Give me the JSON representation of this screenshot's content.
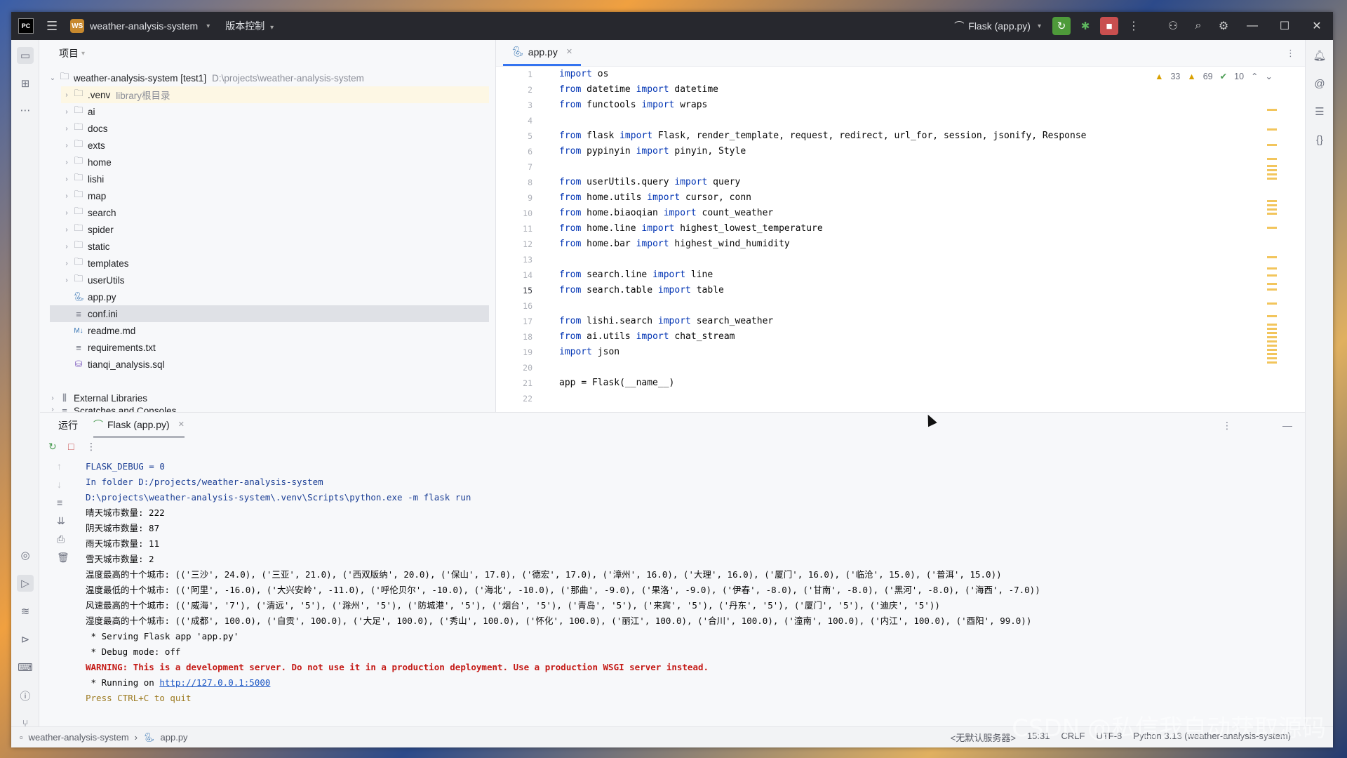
{
  "titlebar": {
    "logo": "PC",
    "project_badge": "WS",
    "project_name": "weather-analysis-system",
    "vcs_label": "版本控制",
    "run_config": "Flask (app.py)"
  },
  "project_pane": {
    "title": "项目",
    "root_label": "weather-analysis-system [test1]",
    "root_path": "D:\\projects\\weather-analysis-system",
    "items": [
      {
        "label": ".venv",
        "note": "library根目录"
      },
      {
        "label": "ai",
        "note": ""
      },
      {
        "label": "docs",
        "note": ""
      },
      {
        "label": "exts",
        "note": ""
      },
      {
        "label": "home",
        "note": ""
      },
      {
        "label": "lishi",
        "note": ""
      },
      {
        "label": "map",
        "note": ""
      },
      {
        "label": "search",
        "note": ""
      },
      {
        "label": "spider",
        "note": ""
      },
      {
        "label": "static",
        "note": ""
      },
      {
        "label": "templates",
        "note": ""
      },
      {
        "label": "userUtils",
        "note": ""
      },
      {
        "label": "app.py",
        "note": ""
      },
      {
        "label": "conf.ini",
        "note": ""
      },
      {
        "label": "readme.md",
        "note": ""
      },
      {
        "label": "requirements.txt",
        "note": ""
      },
      {
        "label": "tianqi_analysis.sql",
        "note": ""
      }
    ],
    "external_libraries": "External Libraries",
    "scratches": "Scratches and Consoles"
  },
  "editor": {
    "tab_label": "app.py",
    "inspections": {
      "warnings": "33",
      "weak_warnings": "69",
      "ok": "10"
    },
    "lines": [
      "import os",
      "from datetime import datetime",
      "from functools import wraps",
      "",
      "from flask import Flask, render_template, request, redirect, url_for, session, jsonify, Response",
      "from pypinyin import pinyin, Style",
      "",
      "from userUtils.query import query",
      "from home.utils import cursor, conn",
      "from home.biaoqian import count_weather",
      "from home.line import highest_lowest_temperature",
      "from home.bar import highest_wind_humidity",
      "",
      "from search.line import line",
      "from search.table import table",
      "",
      "from lishi.search import search_weather",
      "from ai.utils import chat_stream",
      "import json",
      "",
      "app = Flask(__name__)",
      ""
    ]
  },
  "run_panel": {
    "title": "运行",
    "tab_label": "Flask (app.py)",
    "console": [
      {
        "text": "FLASK_DEBUG = 0",
        "style": "c-blue"
      },
      {
        "text": "In folder D:/projects/weather-analysis-system",
        "style": "c-blue"
      },
      {
        "text": "D:\\projects\\weather-analysis-system\\.venv\\Scripts\\python.exe -m flask run",
        "style": "c-blue"
      },
      {
        "text": "晴天城市数量: 222",
        "style": ""
      },
      {
        "text": "阴天城市数量: 87",
        "style": ""
      },
      {
        "text": "雨天城市数量: 11",
        "style": ""
      },
      {
        "text": "雪天城市数量: 2",
        "style": ""
      },
      {
        "text": "温度最高的十个城市: (('三沙', 24.0), ('三亚', 21.0), ('西双版纳', 20.0), ('保山', 17.0), ('德宏', 17.0), ('漳州', 16.0), ('大理', 16.0), ('厦门', 16.0), ('临沧', 15.0), ('普洱', 15.0))",
        "style": ""
      },
      {
        "text": "温度最低的十个城市: (('阿里', -16.0), ('大兴安岭', -11.0), ('呼伦贝尔', -10.0), ('海北', -10.0), ('那曲', -9.0), ('果洛', -9.0), ('伊春', -8.0), ('甘南', -8.0), ('黑河', -8.0), ('海西', -7.0))",
        "style": ""
      },
      {
        "text": "风速最高的十个城市: (('威海', '7'), ('清远', '5'), ('滁州', '5'), ('防城港', '5'), ('烟台', '5'), ('青岛', '5'), ('来宾', '5'), ('丹东', '5'), ('厦门', '5'), ('迪庆', '5'))",
        "style": ""
      },
      {
        "text": "湿度最高的十个城市: (('成都', 100.0), ('自贡', 100.0), ('大足', 100.0), ('秀山', 100.0), ('怀化', 100.0), ('丽江', 100.0), ('合川', 100.0), ('潼南', 100.0), ('内江', 100.0), ('酉阳', 99.0))",
        "style": ""
      },
      {
        "text": " * Serving Flask app 'app.py'",
        "style": ""
      },
      {
        "text": " * Debug mode: off",
        "style": ""
      },
      {
        "text": "WARNING: This is a development server. Do not use it in a production deployment. Use a production WSGI server instead.",
        "style": "c-red"
      },
      {
        "text": " * Running on ",
        "style": "",
        "link": "http://127.0.0.1:5000"
      },
      {
        "text": "Press CTRL+C to quit",
        "style": "c-orange"
      }
    ]
  },
  "statusbar": {
    "crumb_project": "weather-analysis-system",
    "crumb_file": "app.py",
    "server": "<无默认服务器>",
    "position": "15:31",
    "line_sep": "CRLF",
    "encoding": "UTF-8",
    "interpreter": "Python 3.13 (weather-analysis-system)"
  },
  "watermark": "CSDN @私信我自动获取源码"
}
